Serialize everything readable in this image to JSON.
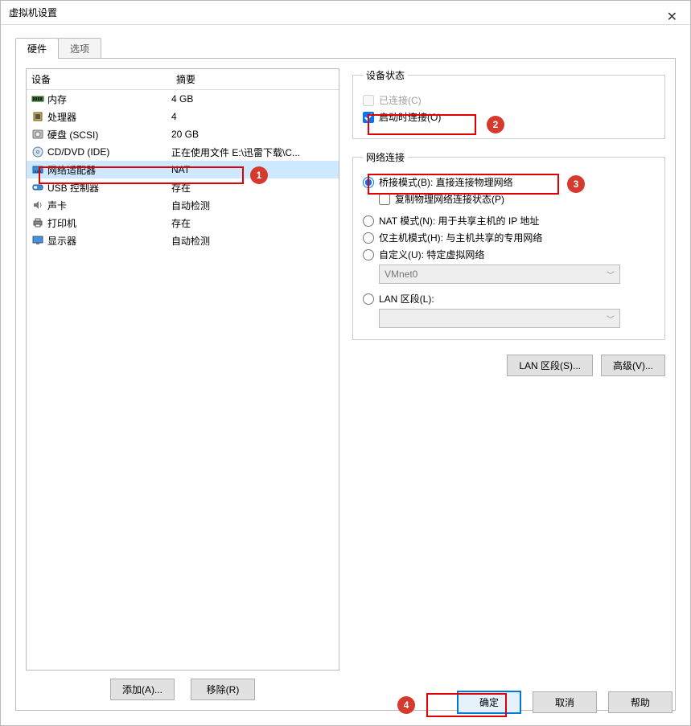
{
  "window": {
    "title": "虚拟机设置"
  },
  "tabs": {
    "hardware": "硬件",
    "options": "选项"
  },
  "hw_header": {
    "device": "设备",
    "summary": "摘要"
  },
  "hw_rows": [
    {
      "icon": "memory-icon",
      "name": "内存",
      "summary": "4 GB"
    },
    {
      "icon": "cpu-icon",
      "name": "处理器",
      "summary": "4"
    },
    {
      "icon": "disk-icon",
      "name": "硬盘 (SCSI)",
      "summary": "20 GB"
    },
    {
      "icon": "cd-icon",
      "name": "CD/DVD (IDE)",
      "summary": "正在使用文件 E:\\迅雷下载\\C..."
    },
    {
      "icon": "nic-icon",
      "name": "网络适配器",
      "summary": "NAT"
    },
    {
      "icon": "usb-icon",
      "name": "USB 控制器",
      "summary": "存在"
    },
    {
      "icon": "sound-icon",
      "name": "声卡",
      "summary": "自动检测"
    },
    {
      "icon": "printer-icon",
      "name": "打印机",
      "summary": "存在"
    },
    {
      "icon": "display-icon",
      "name": "显示器",
      "summary": "自动检测"
    }
  ],
  "selected_row_index": 4,
  "left_buttons": {
    "add": "添加(A)...",
    "remove": "移除(R)"
  },
  "device_status": {
    "legend": "设备状态",
    "connected": "已连接(C)",
    "connect_at_poweron": "启动时连接(O)"
  },
  "net_conn": {
    "legend": "网络连接",
    "bridged": "桥接模式(B): 直接连接物理网络",
    "replicate": "复制物理网络连接状态(P)",
    "nat": "NAT 模式(N): 用于共享主机的 IP 地址",
    "hostonly": "仅主机模式(H): 与主机共享的专用网络",
    "custom": "自定义(U): 特定虚拟网络",
    "custom_combo": "VMnet0",
    "lanseg": "LAN 区段(L):",
    "lanseg_combo": ""
  },
  "right_buttons": {
    "lanseg": "LAN 区段(S)...",
    "advanced": "高级(V)..."
  },
  "footer": {
    "ok": "确定",
    "cancel": "取消",
    "help": "帮助"
  },
  "annotations": {
    "b1": "1",
    "b2": "2",
    "b3": "3",
    "b4": "4"
  }
}
